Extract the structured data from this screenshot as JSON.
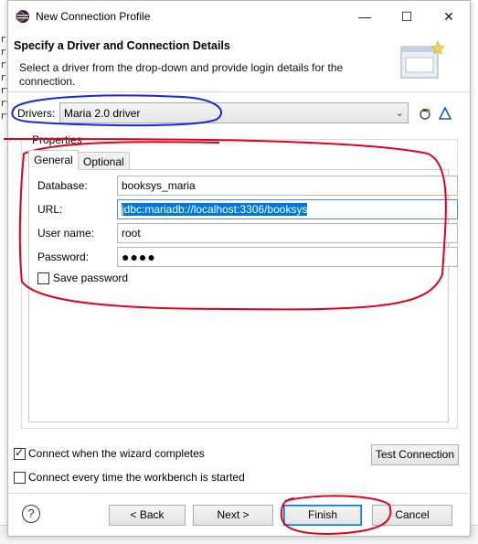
{
  "window": {
    "title": "New Connection Profile",
    "controls": {
      "minimize": "—",
      "maximize": "☐",
      "close": "✕"
    }
  },
  "header": {
    "title": "Specify a Driver and Connection Details",
    "description": "Select a driver from the drop-down and provide login details for the connection."
  },
  "drivers": {
    "label": "Drivers:",
    "selected": "Maria 2.0 driver"
  },
  "properties": {
    "label": "Properties",
    "tabs": [
      {
        "label": "General",
        "active": true
      },
      {
        "label": "Optional",
        "active": false
      }
    ],
    "fields": {
      "database": {
        "label": "Database:",
        "value": "booksys_maria"
      },
      "url": {
        "label": "URL:",
        "value": "jdbc:mariadb://localhost:3306/booksys"
      },
      "username": {
        "label": "User name:",
        "value": "root"
      },
      "password": {
        "label": "Password:",
        "value": "●●●●"
      }
    },
    "save_password": {
      "label": "Save password",
      "checked": false
    }
  },
  "options": {
    "connect_when_complete": {
      "label": "Connect when the wizard completes",
      "checked": true
    },
    "connect_every_time": {
      "label": "Connect every time the workbench is started",
      "checked": false
    },
    "test_connection": "Test Connection"
  },
  "footer": {
    "help": "?",
    "back": "< Back",
    "next": "Next >",
    "finish": "Finish",
    "cancel": "Cancel"
  },
  "background": {
    "left_strip": "ri\nri\nri\nri\nrv\nrv\nrv"
  },
  "colors": {
    "selection": "#0078d7",
    "annotation_blue": "#1428e0",
    "annotation_red": "#e3001b"
  }
}
